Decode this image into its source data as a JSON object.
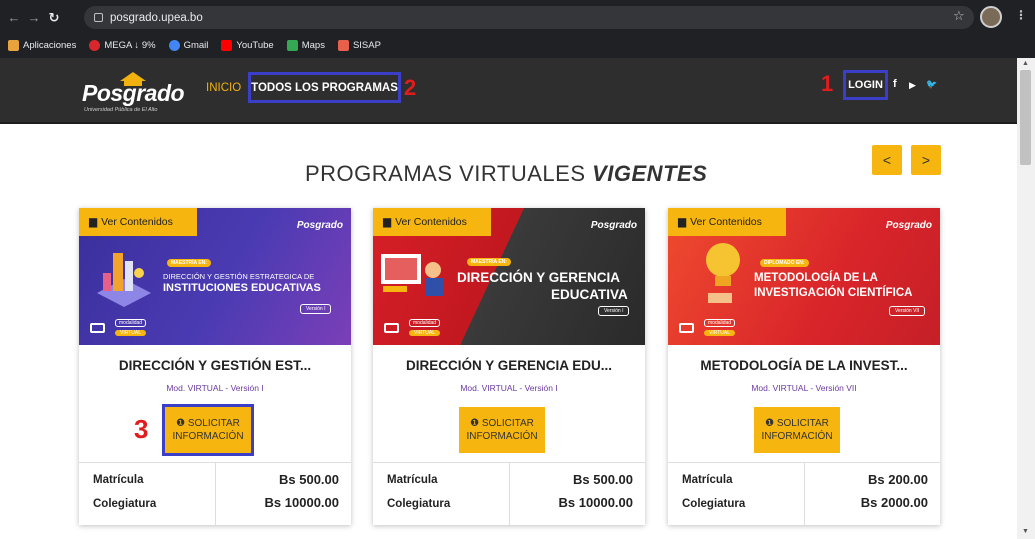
{
  "browser": {
    "url": "posgrado.upea.bo",
    "bookmarks": [
      {
        "label": "Aplicaciones",
        "color": "#e8a33d"
      },
      {
        "label": "MEGA ↓ 9%",
        "color": "#d9272e"
      },
      {
        "label": "Gmail",
        "color": "#4285f4"
      },
      {
        "label": "YouTube",
        "color": "#ff0000"
      },
      {
        "label": "Maps",
        "color": "#34a853"
      },
      {
        "label": "SISAP",
        "color": "#e8604c"
      }
    ]
  },
  "header": {
    "logo_text": "Posgrado",
    "logo_sub": "Universidad Pública de El Alto",
    "nav_inicio": "INICIO",
    "nav_programas": "TODOS LOS PROGRAMAS",
    "login": "LOGIN",
    "social": [
      "f",
      "▶",
      "🐦"
    ]
  },
  "annotations": {
    "a1": "1",
    "a2": "2",
    "a3": "3"
  },
  "section": {
    "title_main": "PROGRAMAS VIRTUALES ",
    "title_emph": "VIGENTES",
    "prev": "<",
    "next": ">"
  },
  "cards": [
    {
      "ver": "Ver Contenidos",
      "banner_logo": "Posgrado",
      "banner_kicker": "MAESTRÍA EN:",
      "banner_line1": "DIRECCIÓN Y GESTIÓN ESTRATEGICA DE",
      "banner_line2": "INSTITUCIONES EDUCATIVAS",
      "banner_version": "Versión I",
      "banner_mod": "modalidad",
      "banner_virt": "VIRTUAL",
      "title": "DIRECCIÓN Y GESTIÓN EST...",
      "subtitle": "Mod. VIRTUAL - Versión I",
      "btn_line1": "SOLICITAR",
      "btn_line2": "INFORMACIÓN",
      "matricula_label": "Matrícula",
      "matricula": "Bs 500.00",
      "colegiatura_label": "Colegiatura",
      "colegiatura": "Bs 10000.00"
    },
    {
      "ver": "Ver Contenidos",
      "banner_logo": "Posgrado",
      "banner_kicker": "MAESTRÍA EN:",
      "banner_line1": "DIRECCIÓN Y GERENCIA",
      "banner_line2": "EDUCATIVA",
      "banner_version": "Versión I",
      "banner_mod": "modalidad",
      "banner_virt": "VIRTUAL",
      "title": "DIRECCIÓN Y GERENCIA EDU...",
      "subtitle": "Mod. VIRTUAL - Versión I",
      "btn_line1": "SOLICITAR",
      "btn_line2": "INFORMACIÓN",
      "matricula_label": "Matrícula",
      "matricula": "Bs 500.00",
      "colegiatura_label": "Colegiatura",
      "colegiatura": "Bs 10000.00"
    },
    {
      "ver": "Ver Contenidos",
      "banner_logo": "Posgrado",
      "banner_kicker": "DIPLOMADO EN:",
      "banner_line1": "METODOLOGÍA DE LA",
      "banner_line2": "INVESTIGACIÓN CIENTÍFICA",
      "banner_version": "Versión VII",
      "banner_mod": "modalidad",
      "banner_virt": "VIRTUAL",
      "title": "METODOLOGÍA DE LA INVEST...",
      "subtitle": "Mod. VIRTUAL - Versión VII",
      "btn_line1": "SOLICITAR",
      "btn_line2": "INFORMACIÓN",
      "matricula_label": "Matrícula",
      "matricula": "Bs 200.00",
      "colegiatura_label": "Colegiatura",
      "colegiatura": "Bs 2000.00"
    }
  ]
}
